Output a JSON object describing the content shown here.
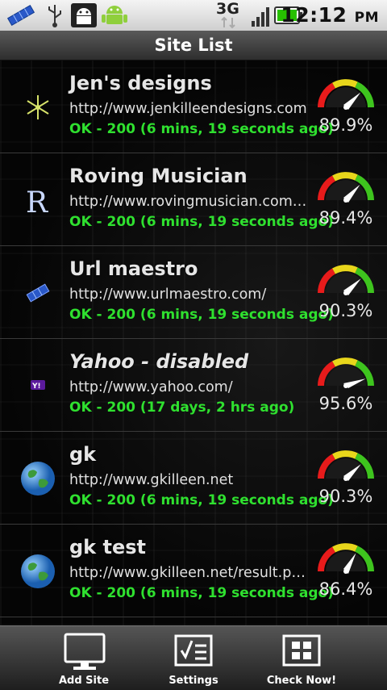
{
  "status_bar": {
    "time": "12:12",
    "ampm": "PM",
    "network": "3G",
    "icons": [
      "satellite-icon",
      "usb-icon",
      "android-debug-icon",
      "android-icon",
      "signal-icon",
      "battery-icon"
    ]
  },
  "title": "Site List",
  "sites": [
    {
      "name": "Jen's designs",
      "url": "http://www.jenkilleendesigns.com",
      "status": "OK - 200 (6 mins, 19 seconds ago)",
      "uptime": "89.9%",
      "uptime_value": 89.9,
      "icon": "snowflake-icon",
      "disabled": false
    },
    {
      "name": "Roving Musician",
      "url": "http://www.rovingmusician.com/p...",
      "status": "OK - 200 (6 mins, 19 seconds ago)",
      "uptime": "89.4%",
      "uptime_value": 89.4,
      "icon": "letter-r-icon",
      "disabled": false
    },
    {
      "name": "Url maestro",
      "url": "http://www.urlmaestro.com/",
      "status": "OK - 200 (6 mins, 19 seconds ago)",
      "uptime": "90.3%",
      "uptime_value": 90.3,
      "icon": "satellite-icon",
      "disabled": false
    },
    {
      "name": "Yahoo - disabled",
      "url": "http://www.yahoo.com/",
      "status": "OK - 200 (17 days, 2 hrs ago)",
      "uptime": "95.6%",
      "uptime_value": 95.6,
      "icon": "yahoo-icon",
      "disabled": true
    },
    {
      "name": "gk",
      "url": "http://www.gkilleen.net",
      "status": "OK - 200 (6 mins, 19 seconds ago)",
      "uptime": "90.3%",
      "uptime_value": 90.3,
      "icon": "globe-icon",
      "disabled": false
    },
    {
      "name": "gk test",
      "url": "http://www.gkilleen.net/result.php...",
      "status": "OK - 200 (6 mins, 19 seconds ago)",
      "uptime": "86.4%",
      "uptime_value": 86.4,
      "icon": "globe-icon",
      "disabled": false
    }
  ],
  "bottom_nav": {
    "add_site": "Add Site",
    "settings": "Settings",
    "check_now": "Check Now!"
  },
  "colors": {
    "status_ok": "#2fe02f",
    "gauge_red": "#e81b1b",
    "gauge_yellow": "#e8d61b",
    "gauge_green": "#3ec41e"
  }
}
